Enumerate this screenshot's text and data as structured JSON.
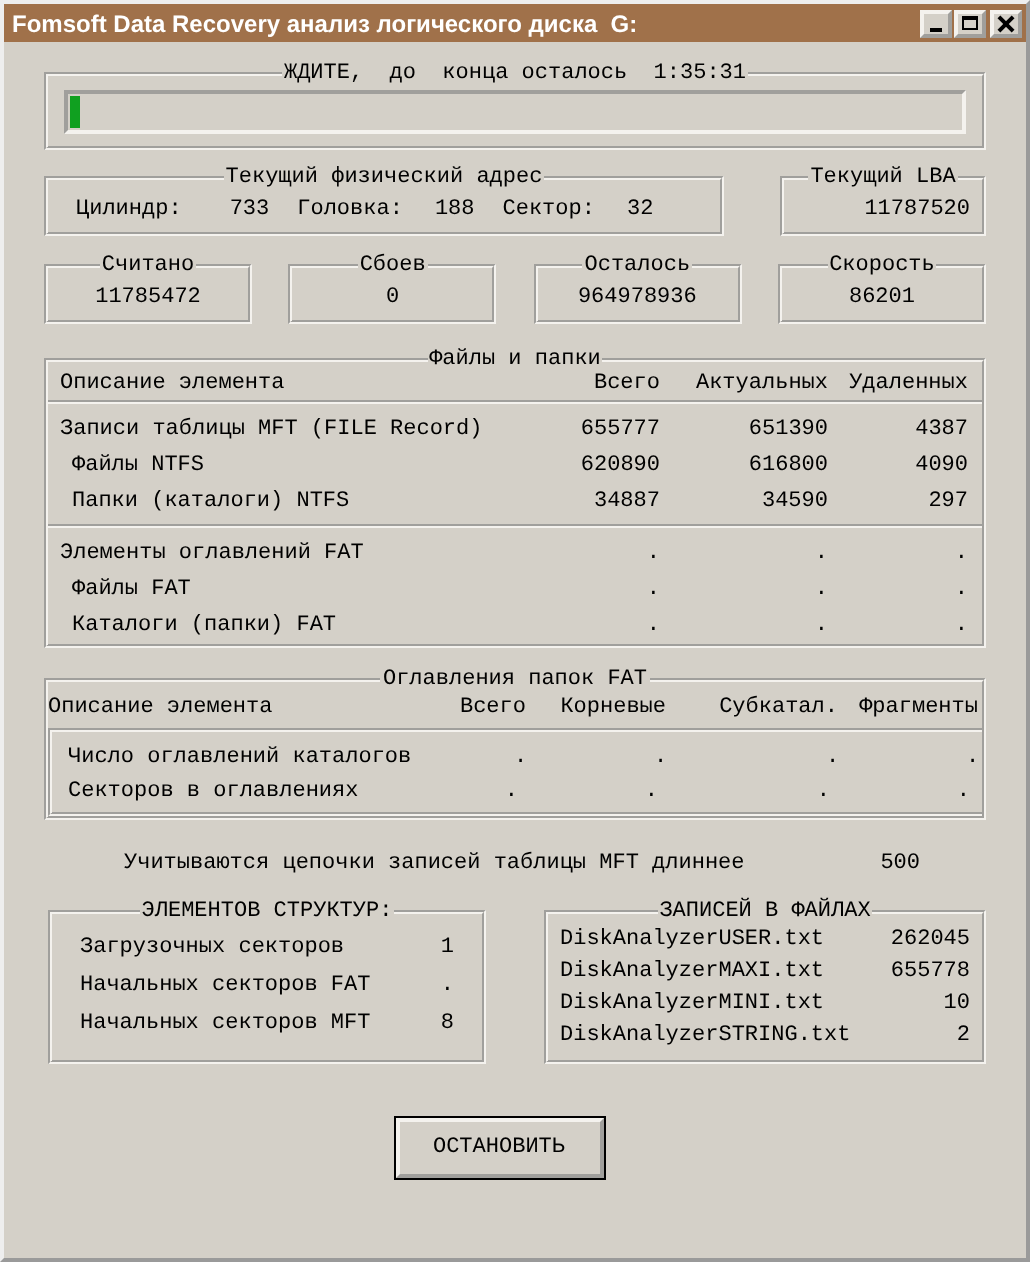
{
  "window": {
    "title": "Fomsoft Data Recovery анализ логического диска  G:"
  },
  "progress": {
    "label": "ЖДИТЕ,  до  конца осталось  1:35:31",
    "level": 0.012
  },
  "physical_address": {
    "title": "Текущий физический адрес",
    "fields": [
      {
        "label": "Цилиндр:",
        "value": "733"
      },
      {
        "label": "Головка:",
        "value": "188"
      },
      {
        "label": "Сектор:",
        "value": "32"
      }
    ]
  },
  "lba": {
    "title": "Текущий LBA",
    "value": "11787520"
  },
  "counters": [
    {
      "title": "Считано",
      "value": "11785472"
    },
    {
      "title": "Сбоев",
      "value": "0"
    },
    {
      "title": "Осталось",
      "value": "964978936"
    },
    {
      "title": "Скорость",
      "value": "86201"
    }
  ],
  "files_and_folders": {
    "title": "Файлы и папки",
    "columns": [
      "Описание элемента",
      "Всего",
      "Актуальных",
      "Удаленных"
    ],
    "groups": [
      [
        {
          "label": "Записи таблицы MFT (FILE Record)",
          "values": [
            "655777",
            "651390",
            "4387"
          ],
          "children": [
            {
              "label": "Файлы NTFS",
              "values": [
                "620890",
                "616800",
                "4090"
              ]
            },
            {
              "label": "Папки (каталоги) NTFS",
              "values": [
                "34887",
                "34590",
                "297"
              ]
            }
          ]
        }
      ],
      [
        {
          "label": "Элементы оглавлений FAT",
          "values": [
            ".",
            ".",
            "."
          ],
          "children": [
            {
              "label": "Файлы FAT",
              "values": [
                ".",
                ".",
                "."
              ]
            },
            {
              "label": "Каталоги (папки) FAT",
              "values": [
                ".",
                ".",
                "."
              ]
            }
          ]
        }
      ]
    ]
  },
  "fat_directories": {
    "title": "Оглавления папок FAT",
    "columns": [
      "Описание элемента",
      "Всего",
      "Корневые",
      "Субкатал.",
      "Фрагменты"
    ],
    "rows": [
      {
        "label": "Число оглавлений каталогов",
        "values": [
          ".",
          ".",
          ".",
          "."
        ]
      },
      {
        "label": "Секторов в оглавлениях",
        "values": [
          ".",
          ".",
          ".",
          "."
        ]
      }
    ]
  },
  "mft_chain": {
    "label": "Учитываются цепочки записей таблицы MFT длиннее",
    "value": "500"
  },
  "structures": {
    "title": "ЭЛЕМЕНТОВ СТРУКТУР:",
    "rows": [
      {
        "label": "Загрузочных секторов",
        "value": "1"
      },
      {
        "label": "Начальных секторов FAT",
        "value": "."
      },
      {
        "label": "Начальных секторов MFT",
        "value": "8"
      }
    ]
  },
  "file_records": {
    "title": "ЗАПИСЕЙ В ФАЙЛАХ",
    "rows": [
      {
        "label": "DiskAnalyzerUSER.txt",
        "value": "262045"
      },
      {
        "label": "DiskAnalyzerMAXI.txt",
        "value": "655778"
      },
      {
        "label": "DiskAnalyzerMINI.txt",
        "value": "10"
      },
      {
        "label": "DiskAnalyzerSTRING.txt",
        "value": "2"
      }
    ]
  },
  "stop_button": {
    "label": "ОСТАНОВИТЬ"
  }
}
